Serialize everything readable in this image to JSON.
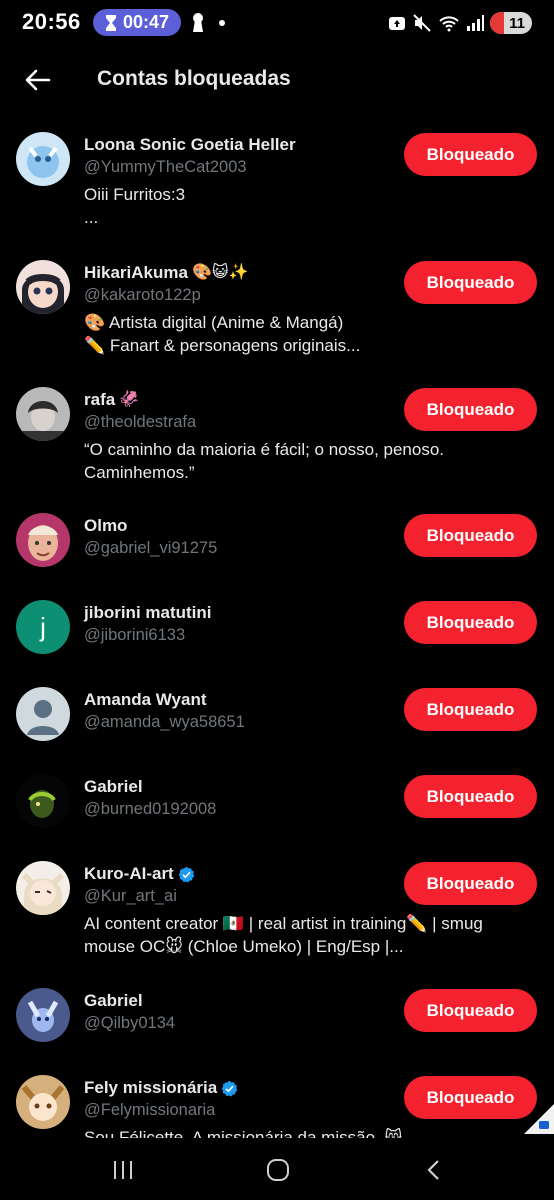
{
  "status_bar": {
    "time": "20:56",
    "timer": "00:47",
    "battery": "11"
  },
  "header": {
    "title": "Contas bloqueadas",
    "back_icon": "arrow-left-icon"
  },
  "accounts": [
    {
      "name": "Loona Sonic Goetia Heller",
      "emojis": "",
      "verified": false,
      "handle": "@YummyTheCat2003",
      "bio": [
        "Oiii Furritos:3",
        "..."
      ],
      "button": "Bloqueado"
    },
    {
      "name": "HikariAkuma",
      "emojis": "🎨😺✨",
      "verified": false,
      "handle": "@kakaroto122p",
      "bio": [
        "🎨 Artista digital (Anime & Mangá)",
        "✏️ Fanart & personagens originais..."
      ],
      "button": "Bloqueado"
    },
    {
      "name": "rafa",
      "emojis": "🦑",
      "verified": false,
      "handle": "@theoldestrafa",
      "bio": [
        "“O caminho da maioria é fácil; o nosso, penoso.",
        "Caminhemos.”"
      ],
      "button": "Bloqueado"
    },
    {
      "name": "Olmo",
      "emojis": "",
      "verified": false,
      "handle": "@gabriel_vi91275",
      "bio": [],
      "button": "Bloqueado"
    },
    {
      "name": "jiborini matutini",
      "emojis": "",
      "verified": false,
      "handle": "@jiborini6133",
      "bio": [],
      "button": "Bloqueado",
      "avatar_letter": "j"
    },
    {
      "name": "Amanda Wyant",
      "emojis": "",
      "verified": false,
      "handle": "@amanda_wya58651",
      "bio": [],
      "button": "Bloqueado"
    },
    {
      "name": "Gabriel",
      "emojis": "",
      "verified": false,
      "handle": "@burned0192008",
      "bio": [],
      "button": "Bloqueado"
    },
    {
      "name": "Kuro-AI-art",
      "emojis": "",
      "verified": true,
      "handle": "@Kur_art_ai",
      "bio": [
        "AI content creator 🇲🇽  | real artist in training✏️ | smug",
        "mouse OC🐭 (Chloe Umeko) | Eng/Esp |..."
      ],
      "button": "Bloqueado"
    },
    {
      "name": "Gabriel",
      "emojis": "",
      "verified": false,
      "handle": "@Qilby0134",
      "bio": [],
      "button": "Bloqueado"
    },
    {
      "name": "Fely missionária",
      "emojis": "",
      "verified": true,
      "handle": "@Felymissionaria",
      "bio": [
        "Sou Félicette. A missionária da missão. 😸"
      ],
      "button": "Bloqueado"
    }
  ],
  "colors": {
    "background": "#000000",
    "button": "#f4212e",
    "handle": "#71767b",
    "verified": "#1d9bf0",
    "timer_pill": "#5b5fd8"
  }
}
